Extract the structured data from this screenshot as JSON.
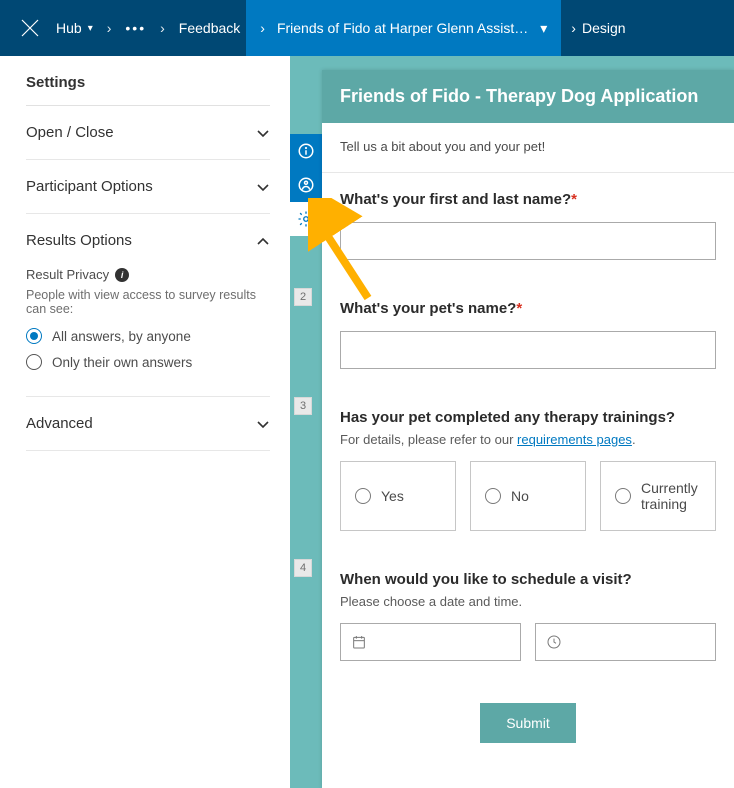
{
  "topbar": {
    "hub_label": "Hub",
    "feedback_label": "Feedback",
    "active_crumb": "Friends of Fido at Harper Glenn Assist…",
    "design_label": "Design"
  },
  "sidebar": {
    "title": "Settings",
    "sections": {
      "open_close": "Open / Close",
      "participant": "Participant Options",
      "results": "Results Options",
      "advanced": "Advanced"
    },
    "results_body": {
      "privacy_label": "Result Privacy",
      "privacy_sub": "People with view access to survey results can see:",
      "opt_all": "All answers, by anyone",
      "opt_own": "Only their own answers"
    }
  },
  "form": {
    "title": "Friends of Fido - Therapy Dog Application",
    "intro": "Tell us a bit about you and your pet!",
    "q1_title": "What's your first and last name?",
    "q2_title": "What's your pet's name?",
    "q3_title": "Has your pet completed any therapy trainings?",
    "q3_hint_prefix": "For details, please refer to our ",
    "q3_hint_link": "requirements pages",
    "q3_opts": {
      "yes": "Yes",
      "no": "No",
      "curr": "Currently training"
    },
    "q4_title": "When would you like to schedule a visit?",
    "q4_hint": "Please choose a date and time.",
    "submit": "Submit"
  }
}
